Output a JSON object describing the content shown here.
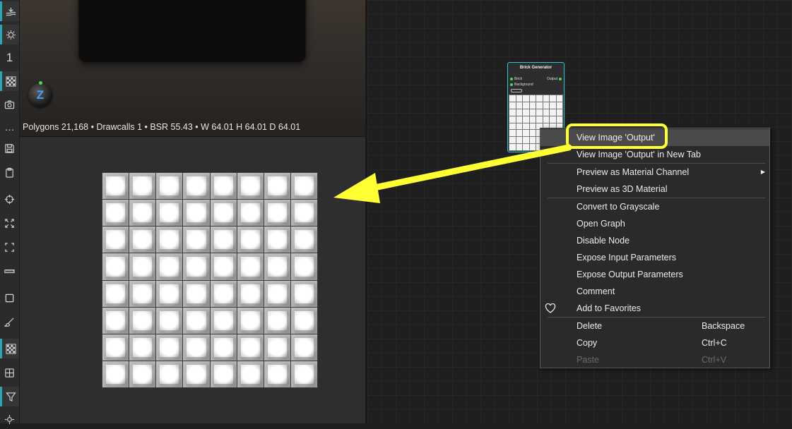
{
  "toolbar": {
    "number_label": "1",
    "more_label": "…"
  },
  "viewport": {
    "stats": "Polygons 21,168 • Drawcalls 1 • BSR 55.43 • W 64.01 H 64.01 D 64.01",
    "gizmo_label": "Z"
  },
  "node": {
    "title": "Brick Generator",
    "inputs": [
      "Brick",
      "Background"
    ],
    "output": "Output",
    "accent_color": "#2cc8d8"
  },
  "context_menu": {
    "items": [
      {
        "label": "View Image 'Output'",
        "shortcut": ""
      },
      {
        "label": "View Image 'Output' in New Tab",
        "shortcut": ""
      },
      {
        "label": "Preview as Material Channel",
        "shortcut": ""
      },
      {
        "label": "Preview as 3D Material",
        "shortcut": ""
      },
      {
        "label": "Convert to Grayscale",
        "shortcut": ""
      },
      {
        "label": "Open Graph",
        "shortcut": ""
      },
      {
        "label": "Disable Node",
        "shortcut": ""
      },
      {
        "label": "Expose Input Parameters",
        "shortcut": ""
      },
      {
        "label": "Expose Output Parameters",
        "shortcut": ""
      },
      {
        "label": "Comment",
        "shortcut": ""
      },
      {
        "label": "Add to Favorites",
        "shortcut": ""
      },
      {
        "label": "Delete",
        "shortcut": "Backspace"
      },
      {
        "label": "Copy",
        "shortcut": "Ctrl+C"
      },
      {
        "label": "Paste",
        "shortcut": "Ctrl+V"
      }
    ]
  },
  "annotation": {
    "color": "#ffff33"
  }
}
